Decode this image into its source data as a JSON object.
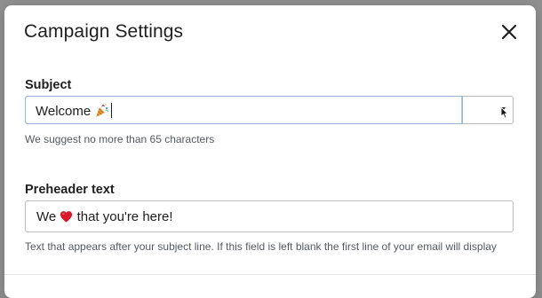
{
  "dialog": {
    "title": "Campaign Settings",
    "close_icon": "close-icon"
  },
  "subject": {
    "label": "Subject",
    "value_text": "Welcome",
    "value_emoji": "party-popper",
    "helper": "We suggest no more than 65 characters",
    "emoji_picker_icon": "caret-down-icon"
  },
  "preheader": {
    "label": "Preheader text",
    "value_before": "We",
    "value_emoji": "red-heart",
    "value_after": "that you're here!",
    "helper": "Text that appears after your subject line. If this field is left blank the first line of your email will display"
  },
  "colors": {
    "focus_ring": "#9fb7d6",
    "border": "#b9bcc1",
    "helper_text": "#555a60",
    "heart": "#d7192a"
  }
}
